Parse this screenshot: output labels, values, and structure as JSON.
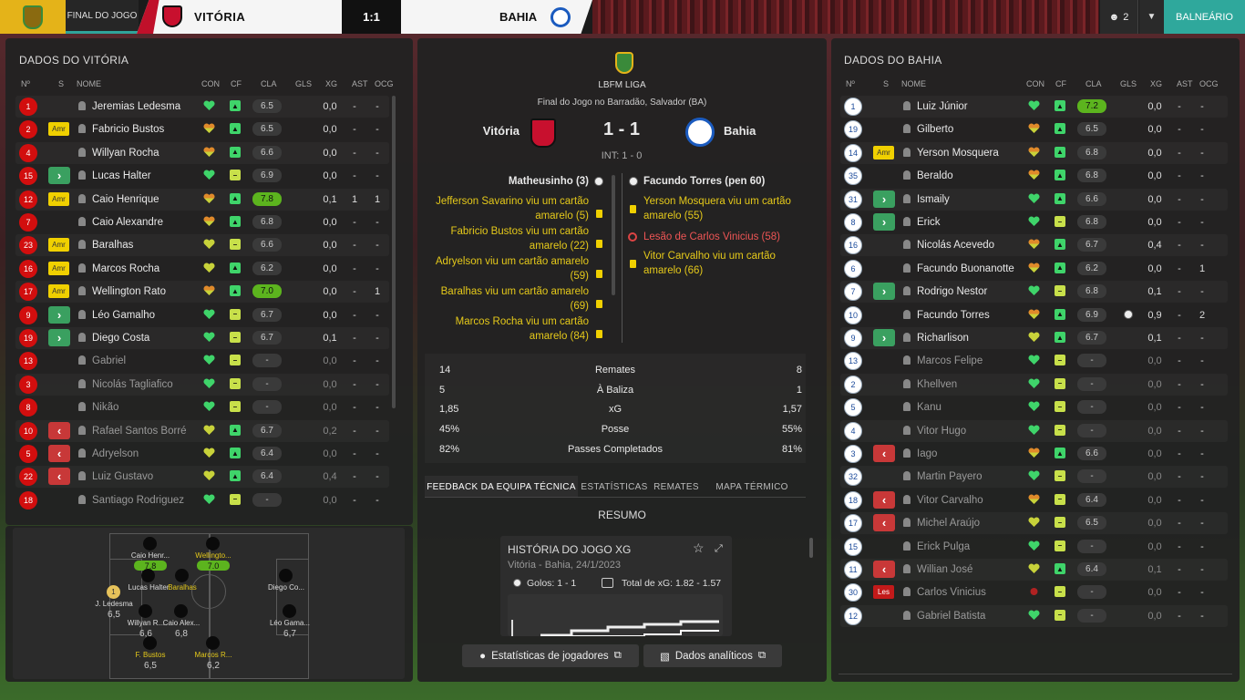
{
  "topbar": {
    "tab_label": "FINAL DO JOGO",
    "home_team": "VITÓRIA",
    "score": "1:1",
    "away_team": "BAHIA",
    "user_count": "2",
    "balneario": "BALNEÁRIO"
  },
  "home_panel": {
    "title": "DADOS DO VITÓRIA",
    "headers": [
      "Nº",
      "S",
      "NOME",
      "CON",
      "CF",
      "CLA",
      "GLS",
      "XG",
      "AST",
      "OCG"
    ],
    "players": [
      {
        "num": "1",
        "card": "",
        "sub": "",
        "name": "Jeremias Ledesma",
        "con": "green",
        "cf": "up",
        "cla": "6.5",
        "hi": false,
        "gls": "",
        "xg": "0,0",
        "ast": "-",
        "ocg": "-",
        "dim": false
      },
      {
        "num": "2",
        "card": "Amr",
        "sub": "",
        "name": "Fabricio Bustos",
        "con": "orange",
        "cf": "up",
        "cla": "6.5",
        "hi": false,
        "gls": "",
        "xg": "0,0",
        "ast": "-",
        "ocg": "-",
        "dim": false
      },
      {
        "num": "4",
        "card": "",
        "sub": "",
        "name": "Willyan Rocha",
        "con": "orange",
        "cf": "up",
        "cla": "6.6",
        "hi": false,
        "gls": "",
        "xg": "0,0",
        "ast": "-",
        "ocg": "-",
        "dim": false
      },
      {
        "num": "15",
        "card": "",
        "sub": "in",
        "name": "Lucas Halter",
        "con": "green",
        "cf": "flat",
        "cla": "6.9",
        "hi": false,
        "gls": "",
        "xg": "0,0",
        "ast": "-",
        "ocg": "-",
        "dim": false
      },
      {
        "num": "12",
        "card": "Amr",
        "sub": "",
        "name": "Caio Henrique",
        "con": "orange",
        "cf": "up",
        "cla": "7.8",
        "hi": true,
        "gls": "",
        "xg": "0,1",
        "ast": "1",
        "ocg": "1",
        "dim": false
      },
      {
        "num": "7",
        "card": "",
        "sub": "",
        "name": "Caio Alexandre",
        "con": "orange",
        "cf": "up",
        "cla": "6.8",
        "hi": false,
        "gls": "",
        "xg": "0,0",
        "ast": "-",
        "ocg": "-",
        "dim": false
      },
      {
        "num": "23",
        "card": "Amr",
        "sub": "",
        "name": "Baralhas",
        "con": "yellow",
        "cf": "flat",
        "cla": "6.6",
        "hi": false,
        "gls": "",
        "xg": "0,0",
        "ast": "-",
        "ocg": "-",
        "dim": false
      },
      {
        "num": "16",
        "card": "Amr",
        "sub": "",
        "name": "Marcos Rocha",
        "con": "yellow",
        "cf": "up",
        "cla": "6.2",
        "hi": false,
        "gls": "",
        "xg": "0,0",
        "ast": "-",
        "ocg": "-",
        "dim": false
      },
      {
        "num": "17",
        "card": "Amr",
        "sub": "",
        "name": "Wellington Rato",
        "con": "orange",
        "cf": "up",
        "cla": "7.0",
        "hi": true,
        "gls": "",
        "xg": "0,0",
        "ast": "-",
        "ocg": "1",
        "dim": false
      },
      {
        "num": "9",
        "card": "",
        "sub": "in",
        "name": "Léo Gamalho",
        "con": "green",
        "cf": "flat",
        "cla": "6.7",
        "hi": false,
        "gls": "",
        "xg": "0,0",
        "ast": "-",
        "ocg": "-",
        "dim": false
      },
      {
        "num": "19",
        "card": "",
        "sub": "in",
        "name": "Diego Costa",
        "con": "green",
        "cf": "flat",
        "cla": "6.7",
        "hi": false,
        "gls": "",
        "xg": "0,1",
        "ast": "-",
        "ocg": "-",
        "dim": false
      },
      {
        "num": "13",
        "card": "",
        "sub": "",
        "name": "Gabriel",
        "con": "green",
        "cf": "flat",
        "cla": "-",
        "hi": false,
        "gls": "",
        "xg": "0,0",
        "ast": "-",
        "ocg": "-",
        "dim": true
      },
      {
        "num": "3",
        "card": "",
        "sub": "",
        "name": "Nicolás Tagliafico",
        "con": "green",
        "cf": "flat",
        "cla": "-",
        "hi": false,
        "gls": "",
        "xg": "0,0",
        "ast": "-",
        "ocg": "-",
        "dim": true
      },
      {
        "num": "8",
        "card": "",
        "sub": "",
        "name": "Nikão",
        "con": "green",
        "cf": "flat",
        "cla": "-",
        "hi": false,
        "gls": "",
        "xg": "0,0",
        "ast": "-",
        "ocg": "-",
        "dim": true
      },
      {
        "num": "10",
        "card": "",
        "sub": "out",
        "name": "Rafael Santos Borré",
        "con": "yellow",
        "cf": "up",
        "cla": "6.7",
        "hi": false,
        "gls": "",
        "xg": "0,2",
        "ast": "-",
        "ocg": "-",
        "dim": true
      },
      {
        "num": "5",
        "card": "",
        "sub": "out",
        "name": "Adryelson",
        "con": "yellow",
        "cf": "up",
        "cla": "6.4",
        "hi": false,
        "gls": "",
        "xg": "0,0",
        "ast": "-",
        "ocg": "-",
        "dim": true
      },
      {
        "num": "22",
        "card": "",
        "sub": "out",
        "name": "Luiz Gustavo",
        "con": "yellow",
        "cf": "up",
        "cla": "6.4",
        "hi": false,
        "gls": "",
        "xg": "0,4",
        "ast": "-",
        "ocg": "-",
        "dim": true
      },
      {
        "num": "18",
        "card": "",
        "sub": "",
        "name": "Santiago Rodriguez",
        "con": "green",
        "cf": "flat",
        "cla": "-",
        "hi": false,
        "gls": "",
        "xg": "0,0",
        "ast": "-",
        "ocg": "-",
        "dim": true
      }
    ]
  },
  "formation": {
    "players": [
      {
        "label": "Caio Henr...",
        "rating": "7.8",
        "yellow": false,
        "hi": true
      },
      {
        "label": "Wellingto...",
        "rating": "7.0",
        "yellow": true,
        "hi": true
      },
      {
        "label": "J. Ledesma",
        "rating": "6,5",
        "yellow": false,
        "hi": false
      },
      {
        "label": "Lucas Halter",
        "rating": "",
        "yellow": false,
        "hi": false
      },
      {
        "label": "Baralhas",
        "rating": "",
        "yellow": true,
        "hi": false
      },
      {
        "label": "Willyan R...",
        "rating": "6,6",
        "yellow": false,
        "hi": false
      },
      {
        "label": "Caio Alex...",
        "rating": "6,8",
        "yellow": false,
        "hi": false
      },
      {
        "label": "Diego Co...",
        "rating": "",
        "yellow": false,
        "hi": false
      },
      {
        "label": "Léo Gama...",
        "rating": "6,7",
        "yellow": false,
        "hi": false
      },
      {
        "label": "F. Bustos",
        "rating": "6,5",
        "yellow": true,
        "hi": false
      },
      {
        "label": "Marcos R...",
        "rating": "6,2",
        "yellow": true,
        "hi": false
      }
    ],
    "gk_num": "1"
  },
  "center": {
    "league": "LBFM LIGA",
    "subtitle": "Final do Jogo no Barradão, Salvador (BA)",
    "home": "Vitória",
    "away": "Bahia",
    "score": "1 - 1",
    "ht": "INT: 1 - 0",
    "home_scorer": "Matheusinho (3)",
    "away_scorer": "Facundo Torres (pen 60)",
    "home_events": [
      "Jefferson Savarino viu um cartão amarelo (5)",
      "Fabricio Bustos viu um cartão amarelo (22)",
      "Adryelson viu um cartão amarelo (59)",
      "Baralhas viu um cartão amarelo (69)",
      "Marcos Rocha viu um cartão amarelo (84)"
    ],
    "away_events": [
      {
        "text": "Yerson Mosquera viu um cartão amarelo (55)",
        "type": "yellow"
      },
      {
        "text": "Lesão de Carlos Vinicius (58)",
        "type": "injury"
      },
      {
        "text": "Vitor Carvalho viu um cartão amarelo (66)",
        "type": "yellow"
      }
    ],
    "stats": [
      {
        "home": "14",
        "label": "Remates",
        "away": "8"
      },
      {
        "home": "5",
        "label": "À Baliza",
        "away": "1"
      },
      {
        "home": "1,85",
        "label": "xG",
        "away": "1,57"
      },
      {
        "home": "45%",
        "label": "Posse",
        "away": "55%"
      },
      {
        "home": "82%",
        "label": "Passes Completados",
        "away": "81%"
      }
    ],
    "tabs": [
      "FEEDBACK DA EQUIPA TÉCNICA",
      "ESTATÍSTICAS",
      "REMATES",
      "MAPA TÉRMICO"
    ],
    "resumo": "RESUMO",
    "xg_card": {
      "title": "HISTÓRIA DO JOGO XG",
      "subtitle": "Vitória - Bahia, 24/1/2023",
      "goals": "Golos: 1 - 1",
      "total": "Total de xG: 1.82 - 1.57"
    },
    "buttons": [
      "Estatísticas de jogadores",
      "Dados analíticos"
    ]
  },
  "away_panel": {
    "title": "DADOS DO BAHIA",
    "headers": [
      "Nº",
      "S",
      "NOME",
      "CON",
      "CF",
      "CLA",
      "GLS",
      "XG",
      "AST",
      "OCG"
    ],
    "players": [
      {
        "num": "1",
        "card": "",
        "sub": "",
        "name": "Luiz Júnior",
        "con": "green",
        "cf": "up",
        "cla": "7.2",
        "hi": true,
        "gls": "",
        "xg": "0,0",
        "ast": "-",
        "ocg": "-",
        "dim": false,
        "ball": false
      },
      {
        "num": "19",
        "card": "",
        "sub": "",
        "name": "Gilberto",
        "con": "orange",
        "cf": "up",
        "cla": "6.5",
        "hi": false,
        "gls": "",
        "xg": "0,0",
        "ast": "-",
        "ocg": "-",
        "dim": false,
        "ball": false
      },
      {
        "num": "14",
        "card": "Amr",
        "sub": "",
        "name": "Yerson Mosquera",
        "con": "orange",
        "cf": "up",
        "cla": "6.8",
        "hi": false,
        "gls": "",
        "xg": "0,0",
        "ast": "-",
        "ocg": "-",
        "dim": false,
        "ball": false
      },
      {
        "num": "35",
        "card": "",
        "sub": "",
        "name": "Beraldo",
        "con": "orange",
        "cf": "up",
        "cla": "6.8",
        "hi": false,
        "gls": "",
        "xg": "0,0",
        "ast": "-",
        "ocg": "-",
        "dim": false,
        "ball": false
      },
      {
        "num": "31",
        "card": "",
        "sub": "in",
        "name": "Ismaily",
        "con": "green",
        "cf": "up",
        "cla": "6.6",
        "hi": false,
        "gls": "",
        "xg": "0,0",
        "ast": "-",
        "ocg": "-",
        "dim": false,
        "ball": false
      },
      {
        "num": "8",
        "card": "",
        "sub": "in",
        "name": "Erick",
        "con": "green",
        "cf": "flat",
        "cla": "6.8",
        "hi": false,
        "gls": "",
        "xg": "0,0",
        "ast": "-",
        "ocg": "-",
        "dim": false,
        "ball": false
      },
      {
        "num": "16",
        "card": "",
        "sub": "",
        "name": "Nicolás Acevedo",
        "con": "orange",
        "cf": "up",
        "cla": "6.7",
        "hi": false,
        "gls": "",
        "xg": "0,4",
        "ast": "-",
        "ocg": "-",
        "dim": false,
        "ball": false
      },
      {
        "num": "6",
        "card": "",
        "sub": "",
        "name": "Facundo Buonanotte",
        "con": "orange",
        "cf": "up",
        "cla": "6.2",
        "hi": false,
        "gls": "",
        "xg": "0,0",
        "ast": "-",
        "ocg": "1",
        "dim": false,
        "ball": false
      },
      {
        "num": "7",
        "card": "",
        "sub": "in",
        "name": "Rodrigo Nestor",
        "con": "green",
        "cf": "flat",
        "cla": "6.8",
        "hi": false,
        "gls": "",
        "xg": "0,1",
        "ast": "-",
        "ocg": "-",
        "dim": false,
        "ball": false
      },
      {
        "num": "10",
        "card": "",
        "sub": "",
        "name": "Facundo Torres",
        "con": "orange",
        "cf": "up",
        "cla": "6.9",
        "hi": false,
        "gls": "",
        "xg": "0,9",
        "ast": "-",
        "ocg": "2",
        "dim": false,
        "ball": true
      },
      {
        "num": "9",
        "card": "",
        "sub": "in",
        "name": "Richarlison",
        "con": "yellow",
        "cf": "up",
        "cla": "6.7",
        "hi": false,
        "gls": "",
        "xg": "0,1",
        "ast": "-",
        "ocg": "-",
        "dim": false,
        "ball": false
      },
      {
        "num": "13",
        "card": "",
        "sub": "",
        "name": "Marcos Felipe",
        "con": "green",
        "cf": "flat",
        "cla": "-",
        "hi": false,
        "gls": "",
        "xg": "0,0",
        "ast": "-",
        "ocg": "-",
        "dim": true,
        "ball": false
      },
      {
        "num": "2",
        "card": "",
        "sub": "",
        "name": "Khellven",
        "con": "green",
        "cf": "flat",
        "cla": "-",
        "hi": false,
        "gls": "",
        "xg": "0,0",
        "ast": "-",
        "ocg": "-",
        "dim": true,
        "ball": false
      },
      {
        "num": "5",
        "card": "",
        "sub": "",
        "name": "Kanu",
        "con": "green",
        "cf": "flat",
        "cla": "-",
        "hi": false,
        "gls": "",
        "xg": "0,0",
        "ast": "-",
        "ocg": "-",
        "dim": true,
        "ball": false
      },
      {
        "num": "4",
        "card": "",
        "sub": "",
        "name": "Vitor Hugo",
        "con": "green",
        "cf": "flat",
        "cla": "-",
        "hi": false,
        "gls": "",
        "xg": "0,0",
        "ast": "-",
        "ocg": "-",
        "dim": true,
        "ball": false
      },
      {
        "num": "3",
        "card": "",
        "sub": "out",
        "name": "Iago",
        "con": "orange",
        "cf": "up",
        "cla": "6.6",
        "hi": false,
        "gls": "",
        "xg": "0,0",
        "ast": "-",
        "ocg": "-",
        "dim": true,
        "ball": false
      },
      {
        "num": "32",
        "card": "",
        "sub": "",
        "name": "Martin Payero",
        "con": "green",
        "cf": "flat",
        "cla": "-",
        "hi": false,
        "gls": "",
        "xg": "0,0",
        "ast": "-",
        "ocg": "-",
        "dim": true,
        "ball": false
      },
      {
        "num": "18",
        "card": "",
        "sub": "out",
        "name": "Vitor Carvalho",
        "con": "orange",
        "cf": "flat",
        "cla": "6.4",
        "hi": false,
        "gls": "",
        "xg": "0,0",
        "ast": "-",
        "ocg": "-",
        "dim": true,
        "ball": false
      },
      {
        "num": "17",
        "card": "",
        "sub": "out",
        "name": "Michel Araújo",
        "con": "yellow",
        "cf": "flat",
        "cla": "6.5",
        "hi": false,
        "gls": "",
        "xg": "0,0",
        "ast": "-",
        "ocg": "-",
        "dim": true,
        "ball": false
      },
      {
        "num": "15",
        "card": "",
        "sub": "",
        "name": "Erick Pulga",
        "con": "green",
        "cf": "flat",
        "cla": "-",
        "hi": false,
        "gls": "",
        "xg": "0,0",
        "ast": "-",
        "ocg": "-",
        "dim": true,
        "ball": false
      },
      {
        "num": "11",
        "card": "",
        "sub": "out",
        "name": "Willian José",
        "con": "yellow",
        "cf": "up",
        "cla": "6.4",
        "hi": false,
        "gls": "",
        "xg": "0,1",
        "ast": "-",
        "ocg": "-",
        "dim": true,
        "ball": false
      },
      {
        "num": "30",
        "card": "Les",
        "sub": "",
        "name": "Carlos Vinicius",
        "con": "injured",
        "cf": "flat",
        "cla": "-",
        "hi": false,
        "gls": "",
        "xg": "0,0",
        "ast": "-",
        "ocg": "-",
        "dim": true,
        "ball": false
      },
      {
        "num": "12",
        "card": "",
        "sub": "",
        "name": "Gabriel Batista",
        "con": "green",
        "cf": "flat",
        "cla": "-",
        "hi": false,
        "gls": "",
        "xg": "0,0",
        "ast": "-",
        "ocg": "-",
        "dim": true,
        "ball": false
      }
    ]
  },
  "colors": {
    "accent": "#2fa89c",
    "home_red": "#d20e0e",
    "highlight_green": "#5cb41e",
    "card_yellow": "#f0d000"
  }
}
